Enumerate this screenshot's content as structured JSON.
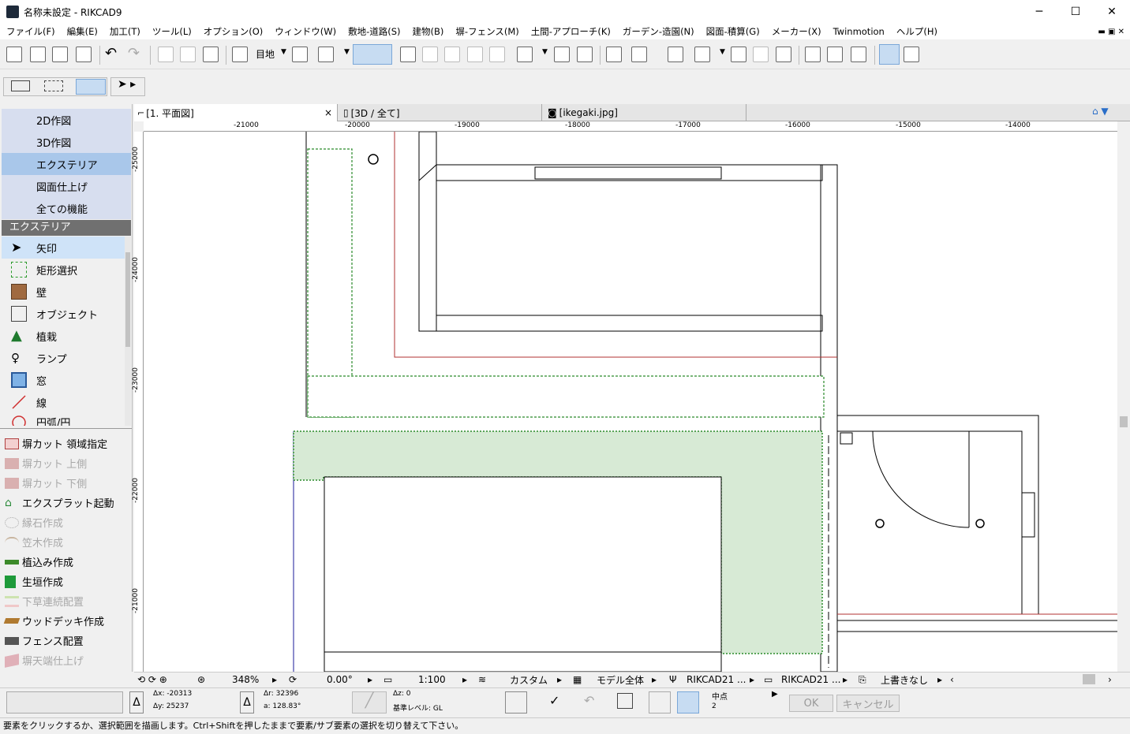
{
  "window": {
    "title": "名称未設定 - RIKCAD9",
    "minimize": "─",
    "maximize": "☐",
    "close": "✕"
  },
  "menu": [
    "ファイル(F)",
    "編集(E)",
    "加工(T)",
    "ツール(L)",
    "オプション(O)",
    "ウィンドウ(W)",
    "敷地-道路(S)",
    "建物(B)",
    "塀-フェンス(M)",
    "土間-アプローチ(K)",
    "ガーデン-造園(N)",
    "図面-積算(G)",
    "メーカー(X)",
    "Twinmotion",
    "ヘルプ(H)"
  ],
  "toolbar": {
    "layer_label": "目地"
  },
  "modes": [
    "2D作図",
    "3D作図",
    "エクステリア",
    "図面仕上げ",
    "全ての機能"
  ],
  "selected_mode": "エクステリア",
  "toolbox": {
    "header": "エクステリア",
    "tools": [
      "矢印",
      "矩形選択",
      "壁",
      "オブジェクト",
      "植栽",
      "ランプ",
      "窓",
      "線",
      "円弧/円"
    ]
  },
  "commands": [
    {
      "label": "塀カット 領域指定",
      "enabled": true
    },
    {
      "label": "塀カット 上側",
      "enabled": false
    },
    {
      "label": "塀カット 下側",
      "enabled": false
    },
    {
      "label": "エクスプラット起動",
      "enabled": true
    },
    {
      "label": "縁石作成",
      "enabled": false
    },
    {
      "label": "笠木作成",
      "enabled": false
    },
    {
      "label": "植込み作成",
      "enabled": true
    },
    {
      "label": "生垣作成",
      "enabled": true
    },
    {
      "label": "下草連続配置",
      "enabled": false
    },
    {
      "label": "ウッドデッキ作成",
      "enabled": true
    },
    {
      "label": "フェンス配置",
      "enabled": true
    },
    {
      "label": "塀天端仕上げ",
      "enabled": false
    }
  ],
  "tabs": [
    {
      "label": "[1. 平面図]",
      "close": "×"
    },
    {
      "label": "[3D / 全て]"
    },
    {
      "label": "[ikegaki.jpg]"
    }
  ],
  "ruler_h": [
    "-21000",
    "-20000",
    "-19000",
    "-18000",
    "-17000",
    "-16000",
    "-15000",
    "-14000"
  ],
  "ruler_v": [
    "-25000",
    "-24000",
    "-23000",
    "-22000",
    "-21000"
  ],
  "nav": {
    "zoom": "348%",
    "angle": "0.00°",
    "scale": "1:100",
    "structure": "カスタム",
    "model": "モデル全体",
    "pen": "RIKCAD21 ...",
    "layer": "RIKCAD21 ...",
    "override": "上書きなし"
  },
  "info": {
    "dx": "Δx: -20313",
    "dy": "Δy: 25237",
    "dr": "Δr: 32396",
    "da": "a: 128.83°",
    "dz": "Δz: 0",
    "level": "基準レベル: GL",
    "midpoint": "中点",
    "midpoint_n": "2",
    "ok": "OK",
    "cancel": "キャンセル"
  },
  "status": "要素をクリックするか、選択範囲を描画します。Ctrl+Shiftを押したままで要素/サブ要素の選択を切り替えて下さい。"
}
